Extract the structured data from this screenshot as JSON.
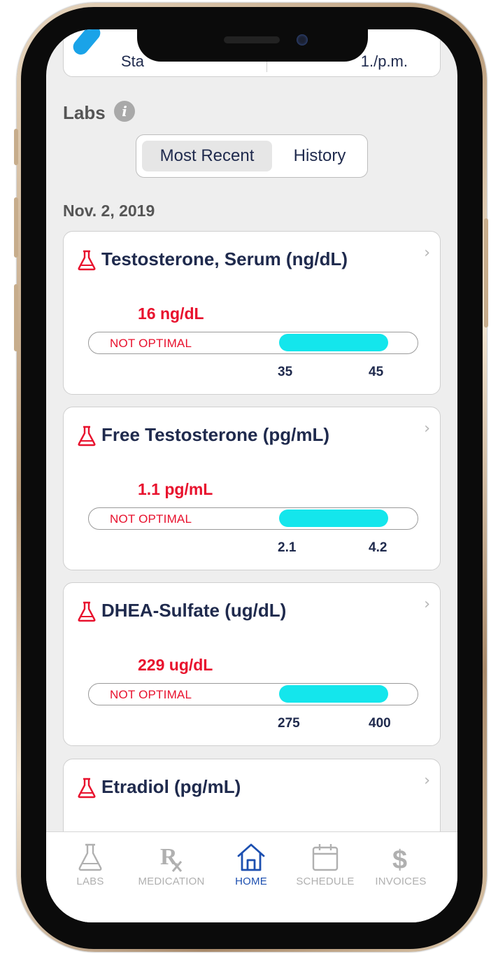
{
  "top_card": {
    "start_text": "Sta",
    "time_text": "1./p.m."
  },
  "labs": {
    "title": "Labs",
    "info_icon": "info-icon"
  },
  "segments": {
    "recent_label": "Most Recent",
    "history_label": "History",
    "selected": "Most Recent"
  },
  "date_label": "Nov. 2, 2019",
  "lab_cards": [
    {
      "title": "Testosterone, Serum (ng/dL)",
      "value": "16 ng/dL",
      "status": "NOT OPTIMAL",
      "range_low": "35",
      "range_high": "45"
    },
    {
      "title": "Free Testosterone (pg/mL)",
      "value": "1.1 pg/mL",
      "status": "NOT OPTIMAL",
      "range_low": "2.1",
      "range_high": "4.2"
    },
    {
      "title": "DHEA-Sulfate (ug/dL)",
      "value": "229 ug/dL",
      "status": "NOT OPTIMAL",
      "range_low": "275",
      "range_high": "400"
    },
    {
      "title": "Etradiol (pg/mL)"
    }
  ],
  "tabbar": {
    "items": [
      {
        "label": "LABS",
        "icon": "flask-icon"
      },
      {
        "label": "MEDICATION",
        "icon": "rx-icon"
      },
      {
        "label": "HOME",
        "icon": "home-icon",
        "active": true
      },
      {
        "label": "SCHEDULE",
        "icon": "calendar-icon"
      },
      {
        "label": "INVOICES",
        "icon": "dollar-icon"
      }
    ]
  },
  "colors": {
    "accent_red": "#e8112d",
    "range_fill": "#14e6ec",
    "active_tab": "#1c4fb0",
    "title_navy": "#1f2a4d"
  }
}
